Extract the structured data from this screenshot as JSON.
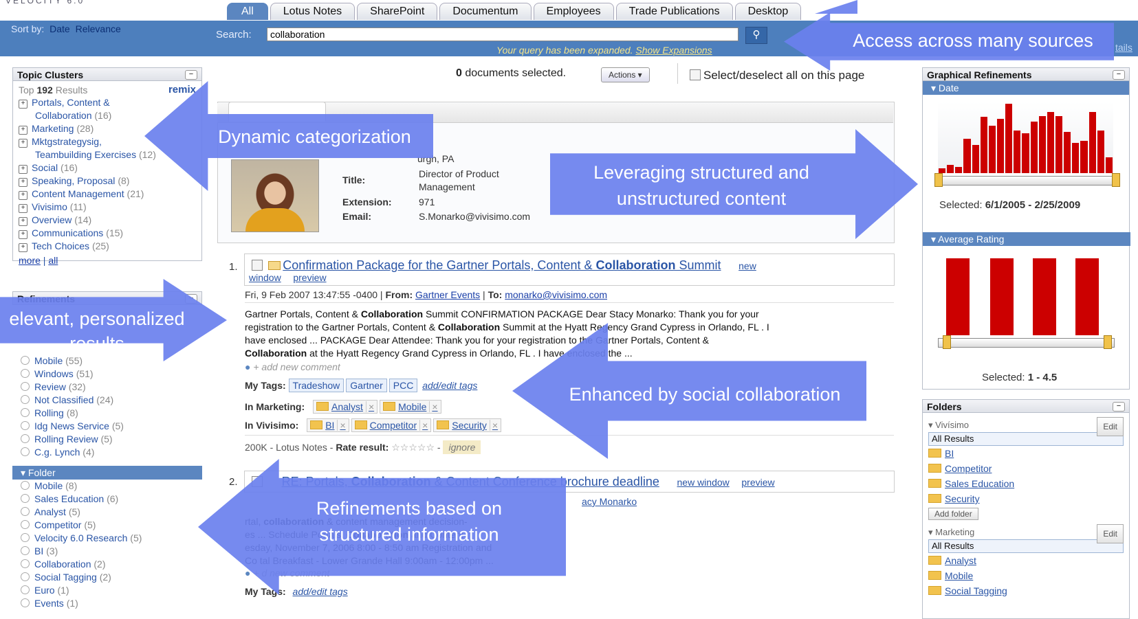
{
  "app": {
    "logo": "VELOCITY 6.0"
  },
  "tabs": [
    "All",
    "Lotus Notes",
    "SharePoint",
    "Documentum",
    "Employees",
    "Trade Publications",
    "Desktop"
  ],
  "sort": {
    "label": "Sort by:",
    "date": "Date",
    "relevance": "Relevance"
  },
  "search": {
    "label": "Search:",
    "value": "collaboration",
    "expanded": "Your query has been expanded.",
    "show_expansions": "Show Expansions",
    "details": "tails"
  },
  "topic_clusters": {
    "title": "Topic Clusters",
    "top_prefix": "Top",
    "top_count": "192",
    "top_suffix": "Results",
    "remix": "remix",
    "items": [
      {
        "label": "Portals, Content &",
        "label2": "Collaboration",
        "count": "(16)"
      },
      {
        "label": "Marketing",
        "count": "(28)"
      },
      {
        "label": "Mktgstrategysig,",
        "label2": "Teambuilding Exercises",
        "count": "(12)"
      },
      {
        "label": "Social",
        "count": "(16)"
      },
      {
        "label": "Speaking, Proposal",
        "count": "(8)"
      },
      {
        "label": "Content Management",
        "count": "(21)"
      },
      {
        "label": "Vivisimo",
        "count": "(11)"
      },
      {
        "label": "Overview",
        "count": "(14)"
      },
      {
        "label": "Communications",
        "count": "(15)"
      },
      {
        "label": "Tech Choices",
        "count": "(25)"
      }
    ],
    "more": "more",
    "all": "all"
  },
  "refinements": {
    "title": "Refinements",
    "items": [
      {
        "label": "Mobile",
        "count": "(55)"
      },
      {
        "label": "Windows",
        "count": "(51)"
      },
      {
        "label": "Review",
        "count": "(32)"
      },
      {
        "label": "Not Classified",
        "count": "(24)"
      },
      {
        "label": "Rolling",
        "count": "(8)"
      },
      {
        "label": "Idg News Service",
        "count": "(5)"
      },
      {
        "label": "Rolling Review",
        "count": "(5)"
      },
      {
        "label": "C.g. Lynch",
        "count": "(4)"
      }
    ],
    "folder_title": "▾ Folder",
    "folder_items": [
      {
        "label": "Mobile",
        "count": "(8)"
      },
      {
        "label": "Sales Education",
        "count": "(6)"
      },
      {
        "label": "Analyst",
        "count": "(5)"
      },
      {
        "label": "Competitor",
        "count": "(5)"
      },
      {
        "label": "Velocity 6.0 Research",
        "count": "(5)"
      },
      {
        "label": "BI",
        "count": "(3)"
      },
      {
        "label": "Collaboration",
        "count": "(2)"
      },
      {
        "label": "Social Tagging",
        "count": "(2)"
      },
      {
        "label": "Euro",
        "count": "(1)"
      },
      {
        "label": "Events",
        "count": "(1)"
      }
    ]
  },
  "selection": {
    "count": "0",
    "text": "documents selected.",
    "actions": "Actions ▾",
    "select_all": "Select/deselect all on this page"
  },
  "person": {
    "location": "urgh, PA",
    "title_label": "Title:",
    "title_value": "Director of Product",
    "title_value2": "Management",
    "ext_label": "Extension:",
    "ext_value": "971",
    "email_label": "Email:",
    "email_value": "S.Monarko@vivisimo.com"
  },
  "results": [
    {
      "num": "1.",
      "title_a": "Confirmation Package for the Gartner Portals, Content & ",
      "title_b": "Collaboration",
      "title_c": " Summit",
      "new_window": "new",
      "new_window2": "window",
      "preview": "preview",
      "date": "Fri, 9 Feb 2007 13:47:55 -0400",
      "from_label": "From:",
      "from": "Gartner Events",
      "to_label": "To:",
      "to": "monarko@vivisimo.com",
      "snippet": [
        "Gartner Portals, Content & Collaboration Summit CONFIRMATION PACKAGE Dear Stacy Monarko: Thank you for your",
        "registration to the Gartner Portals, Content & Collaboration Summit at the Hyatt Regency Grand Cypress in Orlando, FL . I",
        "have enclosed ... PACKAGE Dear Attendee: Thank you for your registration to the Gartner Portals, Content &",
        "Collaboration at the Hyatt Regency Grand Cypress in Orlando, FL . I have enclosed the ..."
      ],
      "add_comment": "+  add new comment",
      "my_tags_label": "My Tags:",
      "tags": [
        "Tradeshow",
        "Gartner",
        "PCC"
      ],
      "add_edit_tags": "add/edit tags",
      "in_marketing_label": "In Marketing:",
      "marketing_folders": [
        "Analyst",
        "Mobile"
      ],
      "in_vivisimo_label": "In Vivisimo:",
      "vivisimo_folders": [
        "BI",
        "Competitor",
        "Security"
      ],
      "size": "200K",
      "source": "Lotus Notes",
      "rate_label": "Rate result:",
      "stars": "☆☆☆☆☆",
      "ignore": "ignore"
    },
    {
      "num": "2.",
      "title_a": "RE: Portals, ",
      "title_b": "Collaboration",
      "title_c": " & Content Conference brochure deadline",
      "new_window": "new window",
      "preview": "preview",
      "person": "acy Monarko",
      "snippet": [
        "rtal, collaboration & content management decision-",
        "es ... Schedule Portals, Collaboration and Content",
        "esday, November 7, 2006 8:00 - 8:50 am Registration and",
        "Co       tal Breakfast - Lower Grande Hall 9:00am - 12:00pm ..."
      ],
      "add_comment": "d new comment",
      "my_tags_label": "My Tags:",
      "add_edit_tags": "add/edit tags"
    }
  ],
  "graphical": {
    "title": "Graphical Refinements",
    "date_title": "▾ Date",
    "date_bars": [
      0.07,
      0.12,
      0.09,
      0.48,
      0.39,
      0.79,
      0.66,
      0.76,
      0.97,
      0.6,
      0.56,
      0.72,
      0.8,
      0.86,
      0.8,
      0.58,
      0.42,
      0.45,
      0.86,
      0.6,
      0.22
    ],
    "date_selected_label": "Selected:",
    "date_selected": "6/1/2005 - 2/25/2009",
    "rating_title": "▾ Average Rating",
    "rating_bars": [
      1,
      1,
      1,
      1
    ],
    "rating_selected_label": "Selected:",
    "rating_selected": "1 - 4.5",
    "bar_color": "#cc0000"
  },
  "folders": {
    "title": "Folders",
    "groups": [
      {
        "name": "▾ Vivísimo",
        "edit": "Edit",
        "all": "All Results",
        "items": [
          "BI",
          "Competitor",
          "Sales Education",
          "Security"
        ],
        "add": "Add folder"
      },
      {
        "name": "▾ Marketing",
        "edit": "Edit",
        "all": "All Results",
        "items": [
          "Analyst",
          "Mobile",
          "Social Tagging"
        ]
      }
    ]
  },
  "callouts": [
    "Access across many sources",
    "Dynamic categorization",
    "Leveraging structured and unstructured content",
    "elevant, personalized results",
    "Enhanced by social collaboration",
    "Refinements based on structured information"
  ],
  "colors": {
    "accent": "#4d7fbd",
    "arrow": "#6a80ee",
    "bar": "#cc0000"
  }
}
